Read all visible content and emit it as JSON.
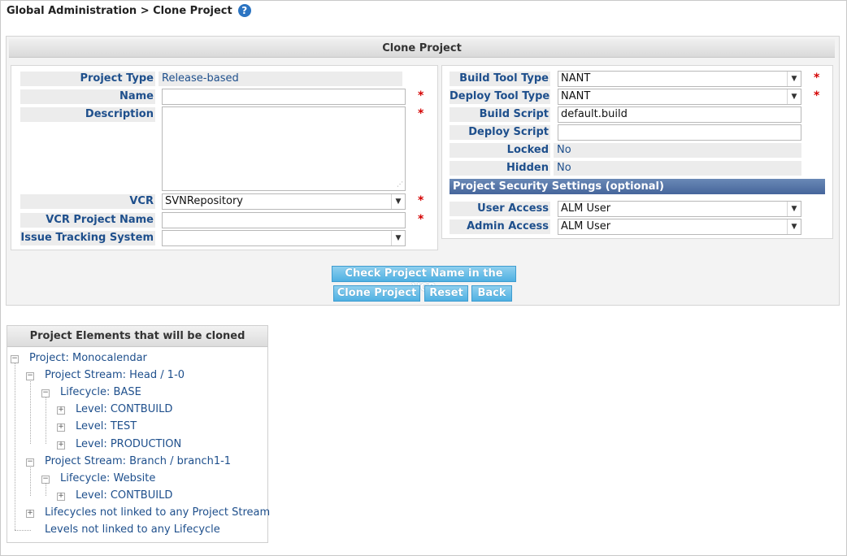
{
  "breadcrumb": {
    "text": "Global Administration > Clone Project",
    "help_icon": "question-circle-icon"
  },
  "panel": {
    "title": "Clone Project"
  },
  "left_form": {
    "project_type": {
      "label": "Project Type",
      "value": "Release-based"
    },
    "name": {
      "label": "Name",
      "value": ""
    },
    "description": {
      "label": "Description",
      "value": ""
    },
    "vcr": {
      "label": "VCR",
      "value": "SVNRepository"
    },
    "vcr_project_name": {
      "label": "VCR Project Name",
      "value": ""
    },
    "issue_tracking": {
      "label": "Issue Tracking System",
      "value": ""
    }
  },
  "right_form": {
    "build_tool_type": {
      "label": "Build Tool Type",
      "value": "NANT"
    },
    "deploy_tool_type": {
      "label": "Deploy Tool Type",
      "value": "NANT"
    },
    "build_script": {
      "label": "Build Script",
      "value": "default.build"
    },
    "deploy_script": {
      "label": "Deploy Script",
      "value": ""
    },
    "locked": {
      "label": "Locked",
      "value": "No"
    },
    "hidden": {
      "label": "Hidden",
      "value": "No"
    },
    "security_header": "Project Security Settings (optional)",
    "user_access": {
      "label": "User Access",
      "value": "ALM User"
    },
    "admin_access": {
      "label": "Admin Access",
      "value": "ALM User"
    }
  },
  "required_marker": "*",
  "buttons": {
    "check_name": "Check Project Name in the VCR",
    "clone": "Clone Project",
    "reset": "Reset",
    "back": "Back"
  },
  "tree": {
    "title": "Project Elements that will be cloned",
    "nodes": [
      "Project: Monocalendar",
      "Project Stream: Head / 1-0",
      "Lifecycle: BASE",
      "Level: CONTBUILD",
      "Level: TEST",
      "Level: PRODUCTION",
      "Project Stream: Branch / branch1-1",
      "Lifecycle: Website",
      "Level: CONTBUILD",
      "Lifecycles not linked to any Project Stream",
      "Levels not linked to any Lifecycle"
    ]
  }
}
